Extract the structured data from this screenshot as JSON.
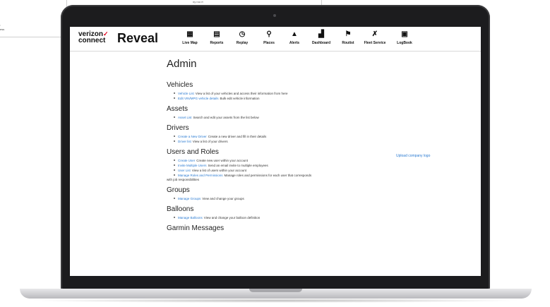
{
  "background": {
    "card_lines": [
      ":",
      "ess"
    ],
    "top_text": "ny roo rt"
  },
  "header": {
    "brand_top": "verizon",
    "brand_bottom": "connect",
    "app_name": "Reveal",
    "nav": [
      {
        "label": "Live Map",
        "icon": "map-icon",
        "glyph": "▦"
      },
      {
        "label": "Reports",
        "icon": "document-icon",
        "glyph": "▤"
      },
      {
        "label": "Replay",
        "icon": "replay-icon",
        "glyph": "◷"
      },
      {
        "label": "Places",
        "icon": "places-icon",
        "glyph": "⚲"
      },
      {
        "label": "Alerts",
        "icon": "alert-icon",
        "glyph": "▲"
      },
      {
        "label": "Dashboard",
        "icon": "dashboard-icon",
        "glyph": "▟"
      },
      {
        "label": "Routist",
        "icon": "route-icon",
        "glyph": "⚑"
      },
      {
        "label": "Fleet Service",
        "icon": "wrench-icon",
        "glyph": "✗"
      },
      {
        "label": "LogBook",
        "icon": "logbook-icon",
        "glyph": "▣"
      }
    ]
  },
  "main": {
    "title": "Admin",
    "upload_link": "Upload company logo",
    "sections": {
      "vehicles": {
        "title": "Vehicles",
        "items": [
          {
            "link": "Vehicle List",
            "text": "View a list of your vehicles and access their information from here"
          },
          {
            "link": "Edit VIN/MPG vehicle details",
            "text": "Bulk edit vehicle information"
          }
        ]
      },
      "assets": {
        "title": "Assets",
        "items": [
          {
            "link": "Asset List",
            "text": "Search and edit your assets from the list below"
          }
        ]
      },
      "drivers": {
        "title": "Drivers",
        "items": [
          {
            "link": "Create a New Driver",
            "text": "Create a new driver and fill in their details"
          },
          {
            "link": "Driver list",
            "text": "View a list of your drivers"
          }
        ]
      },
      "users": {
        "title": "Users and Roles",
        "items": [
          {
            "link": "Create User",
            "text": "Create new user within your account"
          },
          {
            "link": "Invite Multiple Users",
            "text": "Send an email invite to multiple employees"
          },
          {
            "link": "User List",
            "text": "View a list of users within your account"
          },
          {
            "link": "Manage Roles and Permissions",
            "text": "Manage roles and permissions for each user that corresponds"
          }
        ],
        "continuation": "with job responsibilities"
      },
      "groups": {
        "title": "Groups",
        "items": [
          {
            "link": "Manage Groups",
            "text": "View and change your groups"
          }
        ]
      },
      "balloons": {
        "title": "Balloons",
        "items": [
          {
            "link": "Manage Balloons",
            "text": "View and change your balloon definition"
          }
        ]
      },
      "garmin": {
        "title": "Garmin Messages"
      }
    }
  },
  "colors": {
    "link": "#2a7ad1",
    "brand_accent": "#e3001b",
    "laptop_frame": "#1c1c1e"
  }
}
